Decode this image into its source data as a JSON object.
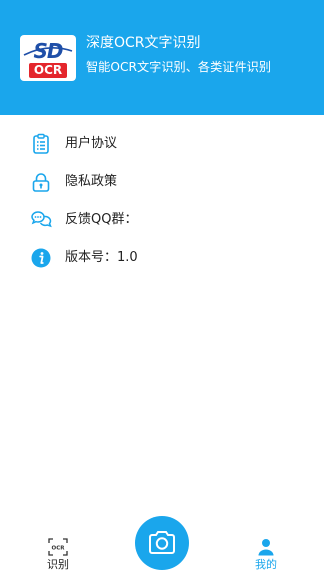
{
  "header": {
    "logo": {
      "top_text": "SD",
      "bottom_text": "OCR"
    },
    "title": "深度OCR文字识别",
    "subtitle": "智能OCR文字识别、各类证件识别"
  },
  "menu": {
    "items": [
      {
        "icon": "clipboard-list-icon",
        "label": "用户协议"
      },
      {
        "icon": "lock-icon",
        "label": "隐私政策"
      },
      {
        "icon": "chat-bubbles-icon",
        "label": "反馈QQ群："
      },
      {
        "icon": "info-icon",
        "label": "版本号：1.0"
      }
    ]
  },
  "bottom_nav": {
    "tabs": [
      {
        "icon": "ocr-scan-icon",
        "label": "识别",
        "active": false
      },
      {
        "icon": "user-icon",
        "label": "我的",
        "active": true
      }
    ],
    "center_button": {
      "icon": "camera-icon"
    }
  },
  "colors": {
    "accent": "#1aa6ec",
    "logo_red": "#e4262c",
    "logo_blue": "#1f4fa8"
  }
}
